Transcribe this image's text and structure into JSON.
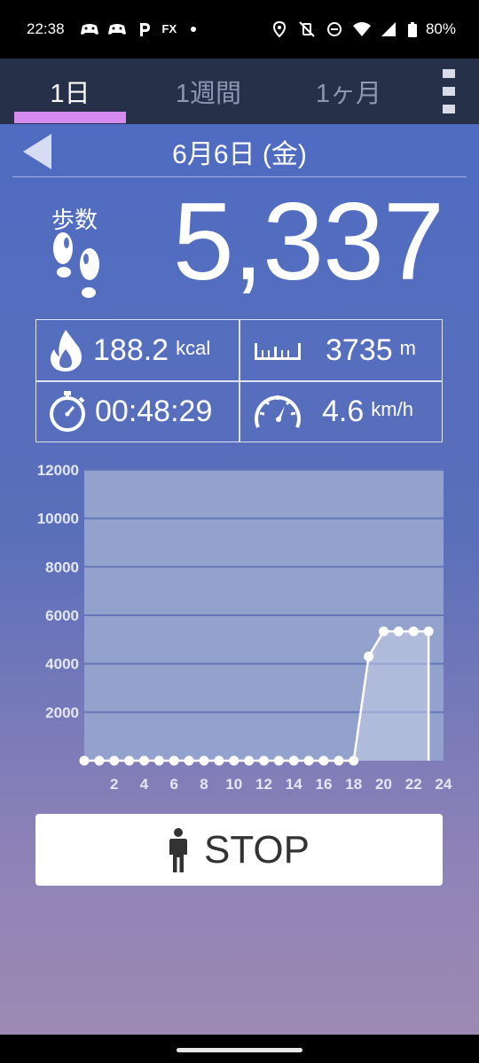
{
  "status_bar": {
    "time": "22:38",
    "fx_label": "FX",
    "battery": "80%",
    "icons": [
      "game-controller-icon",
      "game-controller-icon",
      "parking-icon",
      "fx-icon",
      "dot-icon",
      "location-icon",
      "vibrate-off-icon",
      "do-not-disturb-icon",
      "wifi-icon",
      "signal-icon",
      "battery-icon"
    ]
  },
  "tabs": [
    {
      "label": "1日",
      "active": true
    },
    {
      "label": "1週間",
      "active": false
    },
    {
      "label": "1ヶ月",
      "active": false
    }
  ],
  "header": {
    "date": "6月6日 (金)"
  },
  "steps": {
    "label": "歩数",
    "value": "5,337"
  },
  "stats": {
    "calories": {
      "value": "188.2",
      "unit": "kcal",
      "icon": "flame-icon"
    },
    "distance": {
      "value": "3735",
      "unit": "m",
      "icon": "ruler-icon"
    },
    "duration": {
      "value": "00:48:29",
      "icon": "stopwatch-icon"
    },
    "speed": {
      "value": "4.6",
      "unit": "km/h",
      "icon": "speedometer-icon"
    }
  },
  "chart_data": {
    "type": "area",
    "y_ticks": [
      "12000",
      "10000",
      "8000",
      "6000",
      "4000",
      "2000"
    ],
    "x_ticks": [
      "2",
      "4",
      "6",
      "8",
      "10",
      "12",
      "14",
      "16",
      "18",
      "20",
      "22",
      "24"
    ],
    "ylim": [
      0,
      12000
    ],
    "xlim": [
      0,
      24
    ],
    "grid": true,
    "x": [
      0,
      1,
      2,
      3,
      4,
      5,
      6,
      7,
      8,
      9,
      10,
      11,
      12,
      13,
      14,
      15,
      16,
      17,
      18,
      19,
      20,
      21,
      22,
      23
    ],
    "values": [
      0,
      0,
      0,
      0,
      0,
      0,
      0,
      0,
      0,
      0,
      0,
      0,
      0,
      0,
      0,
      0,
      0,
      0,
      0,
      4300,
      5337,
      5337,
      5337,
      5337
    ],
    "colors": {
      "plot_bg": "#93a2cd",
      "grid": "#6276b8",
      "line": "#ffffff",
      "fill": "#c9cde6",
      "tick": "#e4e7f5"
    }
  },
  "stop_button": {
    "label": "STOP",
    "icon": "person-icon"
  }
}
